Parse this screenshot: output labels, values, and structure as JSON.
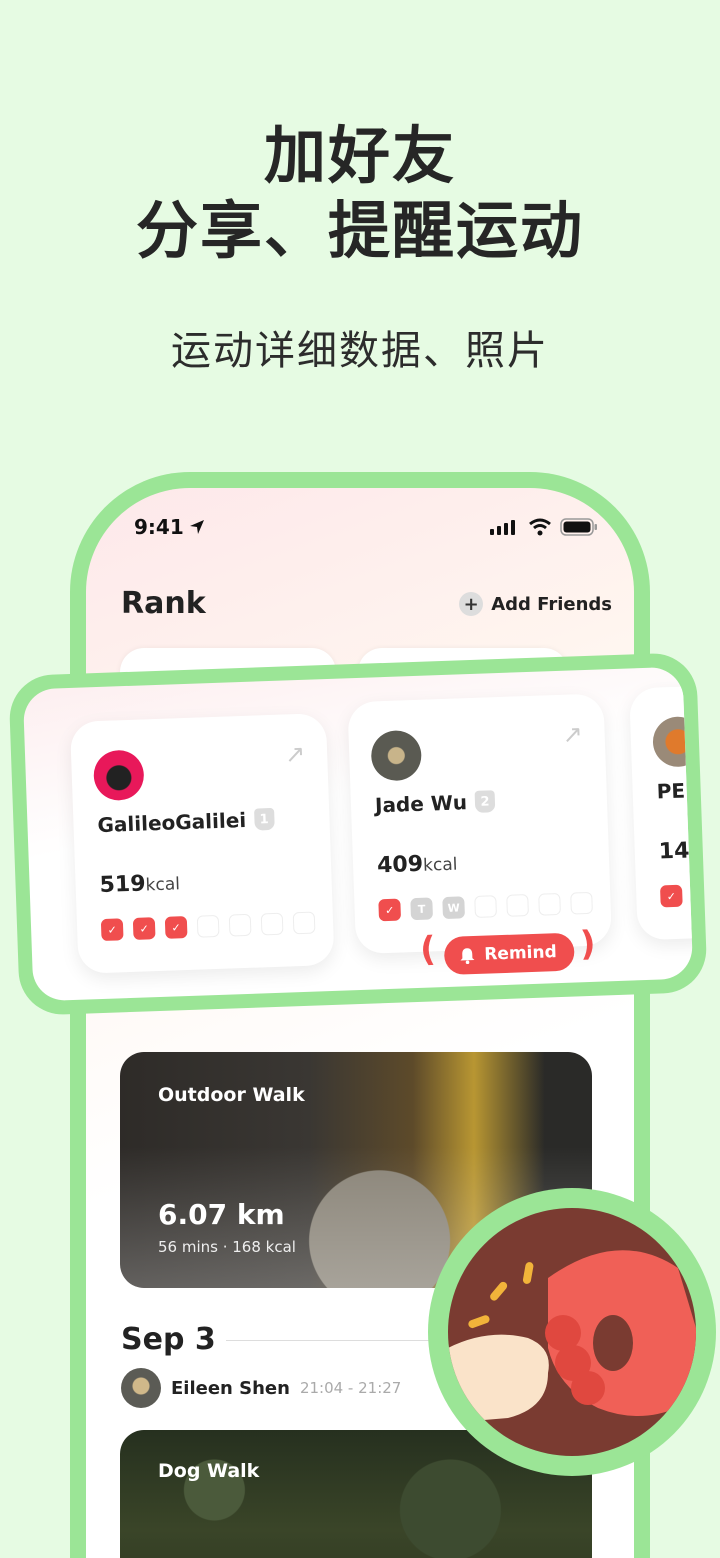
{
  "headline": {
    "line1": "加好友",
    "line2": "分享、提醒运动"
  },
  "subtitle": "运动详细数据、照片",
  "status_bar": {
    "time": "9:41"
  },
  "header": {
    "title": "Rank",
    "add_friends_label": "Add Friends"
  },
  "rank_cards": [
    {
      "name": "GalileoGalilei",
      "rank": "1",
      "kcal": "519",
      "unit": "kcal",
      "days": [
        "done",
        "done",
        "done",
        "empty",
        "empty",
        "empty",
        "empty"
      ]
    },
    {
      "name": "Jade Wu",
      "rank": "2",
      "kcal": "409",
      "unit": "kcal",
      "days": [
        "done",
        "T",
        "W",
        "empty",
        "empty",
        "empty",
        "empty"
      ]
    },
    {
      "name": "PE",
      "kcal": "14"
    }
  ],
  "remind_label": "Remind",
  "feed": [
    {
      "activity": "Outdoor Walk",
      "distance": "6.07 km",
      "meta": "56 mins · 168 kcal"
    }
  ],
  "date_section": {
    "date": "Sep 3",
    "user": "Eileen Shen",
    "time": "21:04 - 21:27"
  },
  "feed2": {
    "activity": "Dog Walk"
  },
  "colors": {
    "accent_green": "#9be596",
    "red": "#f04e4e",
    "bg": "#e6fbe3"
  }
}
